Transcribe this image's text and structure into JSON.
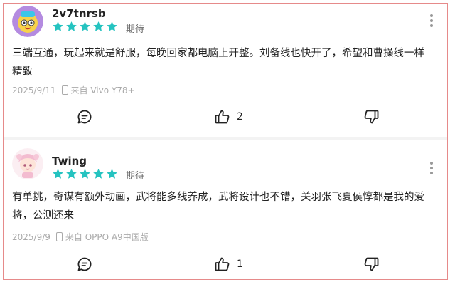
{
  "colors": {
    "star": "#25c3c0",
    "border": "#e68a8a",
    "meta": "#aaaaaa"
  },
  "icons": [
    "avatar",
    "star-icon",
    "more-icon",
    "phone-icon",
    "comment-icon",
    "thumbs-up-icon",
    "thumbs-down-icon"
  ],
  "reviews": [
    {
      "username": "2v7tnrsb",
      "rating": 5,
      "tag": "期待",
      "content_line1": "三端互通，玩起来就是舒服，每晚回家都电脑上开整。刘备线也快开了，希望和曹操线一样",
      "content_line2": "精致",
      "date": "2025/9/11",
      "device": "来自 Vivo Y78+",
      "likes": "2"
    },
    {
      "username": "Twing",
      "rating": 5,
      "tag": "期待",
      "content_line1": "有单挑，奇谋有额外动画，武将能多线养成，武将设计也不错，关羽张飞夏侯惇都是我的爱",
      "content_line2": "将，公测还来",
      "date": "2025/9/9",
      "device": "来自 OPPO A9中国版",
      "likes": "1"
    }
  ]
}
